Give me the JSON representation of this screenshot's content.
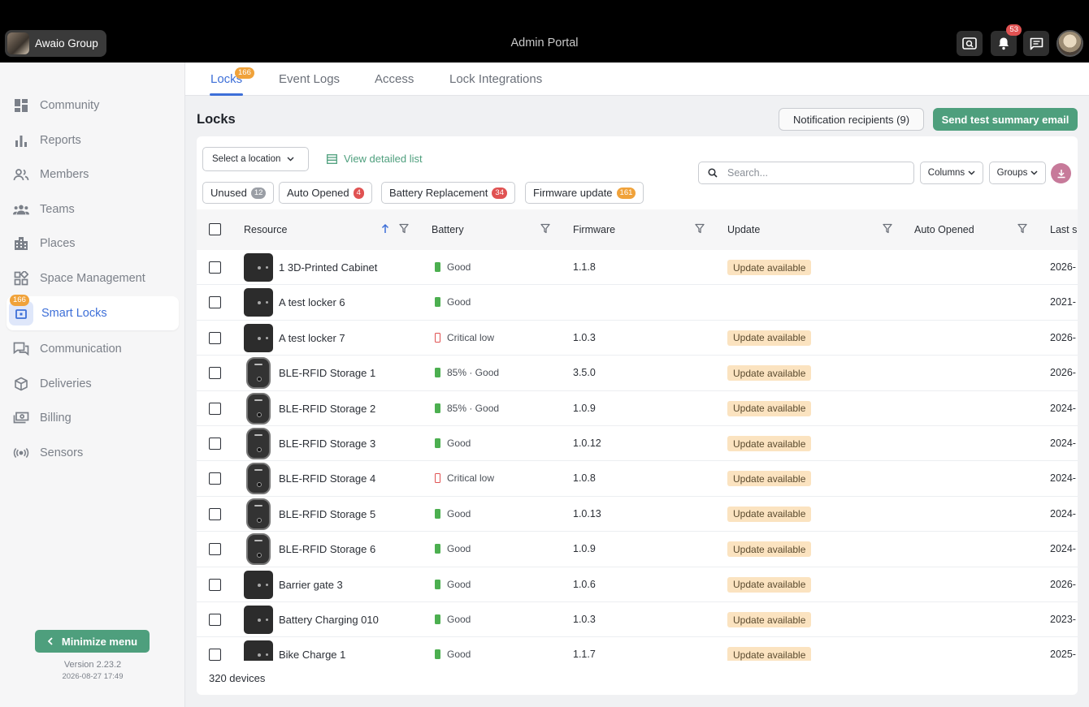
{
  "topbar": {
    "org_name": "Awaio Group",
    "portal_title": "Admin Portal",
    "notifications_count": "53"
  },
  "sidebar": {
    "items": [
      {
        "label": "Community",
        "icon": "dashboard-icon"
      },
      {
        "label": "Reports",
        "icon": "bar-chart-icon"
      },
      {
        "label": "Members",
        "icon": "members-icon"
      },
      {
        "label": "Teams",
        "icon": "teams-icon"
      },
      {
        "label": "Places",
        "icon": "building-icon"
      },
      {
        "label": "Space Management",
        "icon": "widgets-icon"
      },
      {
        "label": "Smart Locks",
        "icon": "lock-icon",
        "badge": "166",
        "active": true
      },
      {
        "label": "Communication",
        "icon": "chat-icon"
      },
      {
        "label": "Deliveries",
        "icon": "package-icon"
      },
      {
        "label": "Billing",
        "icon": "billing-icon"
      },
      {
        "label": "Sensors",
        "icon": "sensors-icon"
      }
    ],
    "minimize_label": "Minimize menu",
    "version": "Version 2.23.2",
    "build_date": "2026-08-27 17:49"
  },
  "tabs": [
    {
      "label": "Locks",
      "badge": "166",
      "active": true
    },
    {
      "label": "Event Logs"
    },
    {
      "label": "Access"
    },
    {
      "label": "Lock Integrations"
    }
  ],
  "main": {
    "title": "Locks",
    "notification_recipients_label": "Notification recipients (9)",
    "send_test_label": "Send test summary email",
    "location_select": "Select a location",
    "view_detailed_list": "View detailed list",
    "search_placeholder": "Search...",
    "columns_label": "Columns",
    "groups_label": "Groups",
    "chips": [
      {
        "label": "Unused",
        "count": "12",
        "color": "#9a9ea5"
      },
      {
        "label": "Auto Opened",
        "count": "4",
        "color": "#e05252"
      },
      {
        "label": "Battery Replacement",
        "count": "34",
        "color": "#e05252"
      },
      {
        "label": "Firmware update",
        "count": "161",
        "color": "#f0a23a"
      }
    ],
    "columns": [
      "Resource",
      "Battery",
      "Firmware",
      "Update",
      "Auto Opened",
      "Last s"
    ],
    "rows": [
      {
        "resource": "1 3D-Printed Cabinet",
        "thumb": "box",
        "battery": "Good",
        "battery_state": "good",
        "firmware": "1.1.8",
        "update": "Update available",
        "last": "2026-"
      },
      {
        "resource": "A test locker 6",
        "thumb": "box",
        "battery": "Good",
        "battery_state": "good",
        "firmware": "",
        "update": "",
        "last": "2021-"
      },
      {
        "resource": "A test locker 7",
        "thumb": "box",
        "battery": "Critical low",
        "battery_state": "critical",
        "firmware": "1.0.3",
        "update": "Update available",
        "last": "2026-"
      },
      {
        "resource": "BLE-RFID Storage 1",
        "thumb": "round",
        "battery": "85% · Good",
        "battery_state": "good",
        "firmware": "3.5.0",
        "update": "Update available",
        "last": "2026-"
      },
      {
        "resource": "BLE-RFID Storage 2",
        "thumb": "round",
        "battery": "85% · Good",
        "battery_state": "good",
        "firmware": "1.0.9",
        "update": "Update available",
        "last": "2024-"
      },
      {
        "resource": "BLE-RFID Storage 3",
        "thumb": "round",
        "battery": "Good",
        "battery_state": "good",
        "firmware": "1.0.12",
        "update": "Update available",
        "last": "2024-"
      },
      {
        "resource": "BLE-RFID Storage 4",
        "thumb": "round",
        "battery": "Critical low",
        "battery_state": "critical",
        "firmware": "1.0.8",
        "update": "Update available",
        "last": "2024-"
      },
      {
        "resource": "BLE-RFID Storage 5",
        "thumb": "round",
        "battery": "Good",
        "battery_state": "good",
        "firmware": "1.0.13",
        "update": "Update available",
        "last": "2024-"
      },
      {
        "resource": "BLE-RFID Storage 6",
        "thumb": "round",
        "battery": "Good",
        "battery_state": "good",
        "firmware": "1.0.9",
        "update": "Update available",
        "last": "2024-"
      },
      {
        "resource": "Barrier gate 3",
        "thumb": "box",
        "battery": "Good",
        "battery_state": "good",
        "firmware": "1.0.6",
        "update": "Update available",
        "last": "2026-"
      },
      {
        "resource": "Battery Charging 010",
        "thumb": "box",
        "battery": "Good",
        "battery_state": "good",
        "firmware": "1.0.3",
        "update": "Update available",
        "last": "2023-"
      },
      {
        "resource": "Bike Charge 1",
        "thumb": "box",
        "battery": "Good",
        "battery_state": "good",
        "firmware": "1.1.7",
        "update": "Update available",
        "last": "2025-"
      }
    ],
    "device_count": "320 devices"
  }
}
